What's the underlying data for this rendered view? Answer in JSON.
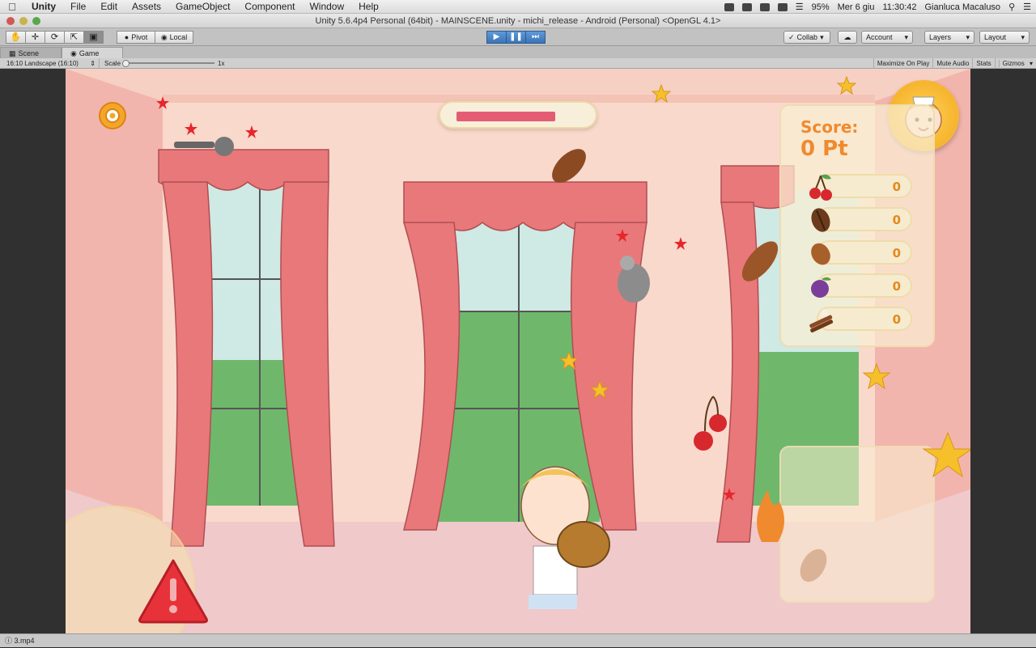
{
  "menubar": {
    "app": "Unity",
    "items": [
      "File",
      "Edit",
      "Assets",
      "GameObject",
      "Component",
      "Window",
      "Help"
    ],
    "battery": "95%",
    "date": "Mer 6 giu",
    "time": "11:30:42",
    "user": "Gianluca Macaluso"
  },
  "window": {
    "title": "Unity 5.6.4p4 Personal (64bit) - MAINSCENE.unity - michi_release - Android (Personal) <OpenGL 4.1>"
  },
  "toolbar": {
    "pivot_label": "Pivot",
    "local_label": "Local",
    "collab_label": "Collab",
    "account_label": "Account",
    "layers_label": "Layers",
    "layout_label": "Layout"
  },
  "tabs": {
    "scene": "Scene",
    "game": "Game"
  },
  "game_toolbar": {
    "aspect": "16:10 Landscape (16:10)",
    "scale_label": "Scale",
    "scale_value": "1x",
    "maximize": "Maximize On Play",
    "mute": "Mute Audio",
    "stats": "Stats",
    "gizmos": "Gizmos"
  },
  "game": {
    "score_label": "Score:",
    "score_value": "0 Pt",
    "progress_fraction": 0.8,
    "items": [
      {
        "icon": "cherry-icon",
        "count": "0"
      },
      {
        "icon": "cocoa-bean-icon",
        "count": "0"
      },
      {
        "icon": "almond-icon",
        "count": "0"
      },
      {
        "icon": "plum-icon",
        "count": "0"
      },
      {
        "icon": "cinnamon-icon",
        "count": "0"
      }
    ]
  },
  "statusbar": {
    "text": "3.mp4"
  }
}
